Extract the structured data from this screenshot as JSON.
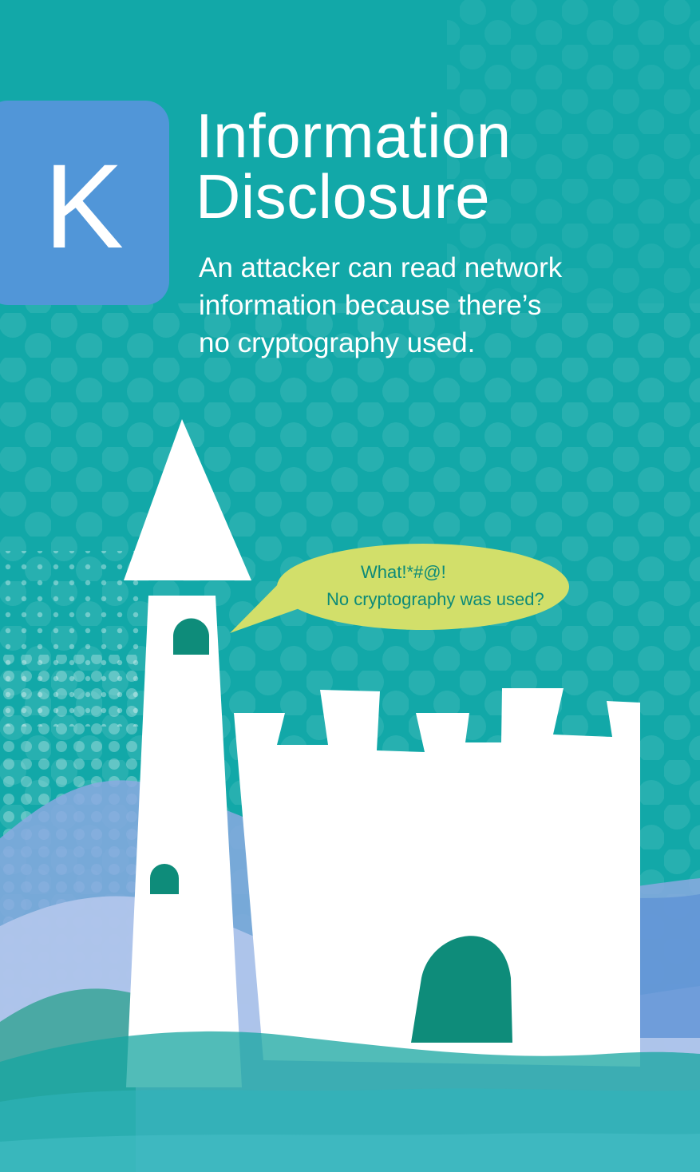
{
  "card": {
    "letter": "K",
    "title_line1": "Information",
    "title_line2": "Disclosure",
    "description_lines": [
      "An attacker can read network",
      "information because there’s",
      "no cryptography used."
    ]
  },
  "speech_bubble": {
    "line1": "What!*#@!",
    "line2": "No cryptography was used?"
  },
  "colors": {
    "background": "#12a8a8",
    "badge": "#5196d8",
    "bubble": "#d2df6a",
    "bubble_text": "#0c8a78",
    "window": "#0e8c7a",
    "castle": "#ffffff"
  },
  "icons": {
    "illustration": "castle-icon"
  }
}
